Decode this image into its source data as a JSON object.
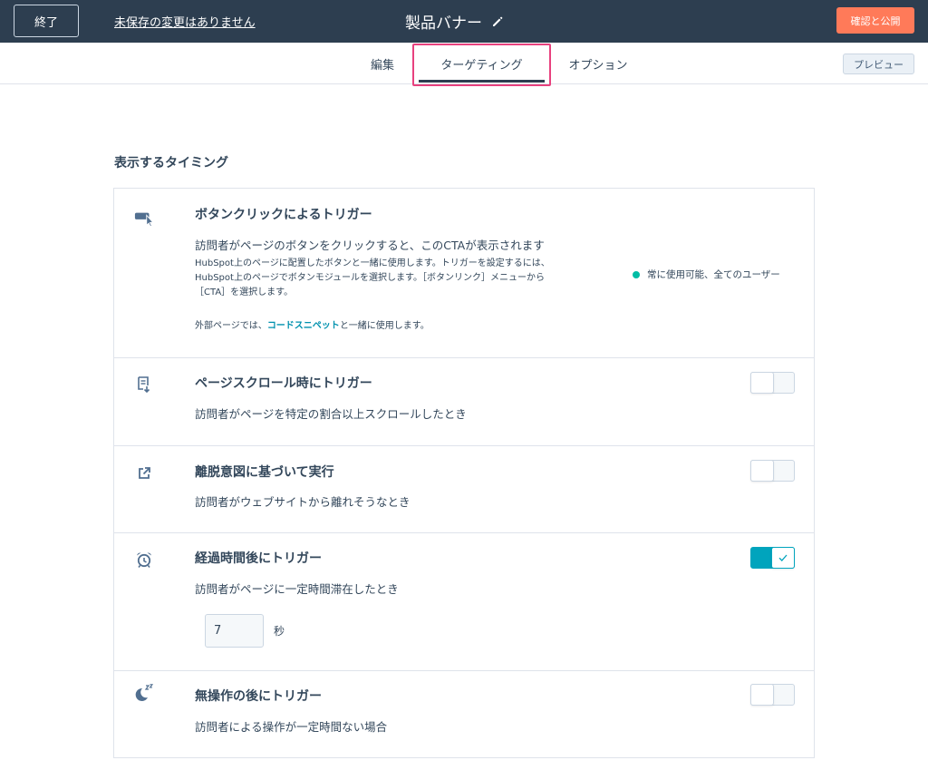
{
  "header": {
    "exit_label": "終了",
    "unsaved_text": "未保存の変更はありません",
    "title": "製品バナー",
    "publish_label": "確認と公開",
    "colors": {
      "bar": "#2d3e50",
      "publish": "#ff7a59"
    }
  },
  "tabs": {
    "edit": "編集",
    "targeting": "ターゲティング",
    "options": "オプション",
    "active": "targeting",
    "highlight_color": "#e8417e"
  },
  "preview_label": "プレビュー",
  "section_heading": "表示するタイミング",
  "triggers": {
    "button_click": {
      "title": "ボタンクリックによるトリガー",
      "description": "訪問者がページのボタンをクリックすると、このCTAが表示されます",
      "note_line1": "HubSpot上のページに配置したボタンと一緒に使用します。トリガーを設定するには、",
      "note_line2": "HubSpot上のページでボタンモジュールを選択します。［ボタンリンク］メニューから",
      "note_line3": "［CTA］を選択します。",
      "external_prefix": "外部ページでは、",
      "external_link": "コードスニペット",
      "external_suffix": "と一緒に使用します。",
      "status_text": "常に使用可能、全てのユーザー",
      "status_color": "#00bda5",
      "icon": "cursor-click-icon"
    },
    "page_scroll": {
      "title": "ページスクロール時にトリガー",
      "description": "訪問者がページを特定の割合以上スクロールしたとき",
      "enabled": false,
      "icon": "scroll-page-icon"
    },
    "exit_intent": {
      "title": "離脱意図に基づいて実行",
      "description": "訪問者がウェブサイトから離れそうなとき",
      "enabled": false,
      "icon": "external-link-icon"
    },
    "elapsed_time": {
      "title": "経過時間後にトリガー",
      "description": "訪問者がページに一定時間滞在したとき",
      "enabled": true,
      "seconds_value": "7",
      "unit": "秒",
      "toggle_color": "#00a4bd",
      "icon": "alarm-clock-icon"
    },
    "inactivity": {
      "title": "無操作の後にトリガー",
      "description": "訪問者による操作が一定時間ない場合",
      "enabled": false,
      "icon": "sleep-moon-icon"
    }
  }
}
